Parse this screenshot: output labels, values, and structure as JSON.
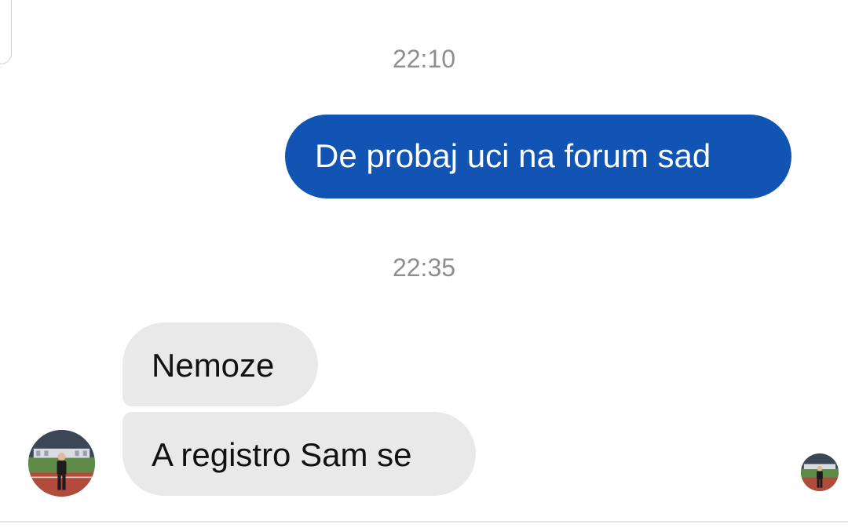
{
  "conversation": {
    "messages": [
      {
        "timestamp": "22:10",
        "direction": "sent",
        "text": "De probaj uci na forum sad"
      },
      {
        "timestamp": "22:35",
        "direction": "received",
        "text": "Nemoze"
      },
      {
        "direction": "received",
        "text": "A registro Sam se"
      }
    ]
  },
  "colors": {
    "sent_bubble": "#1254b4",
    "received_bubble": "#e9e9e9",
    "timestamp_text": "#8e8e8e"
  },
  "icons": {
    "contact_avatar": "contact-avatar-photo",
    "read_receipt": "seen-avatar-photo"
  }
}
